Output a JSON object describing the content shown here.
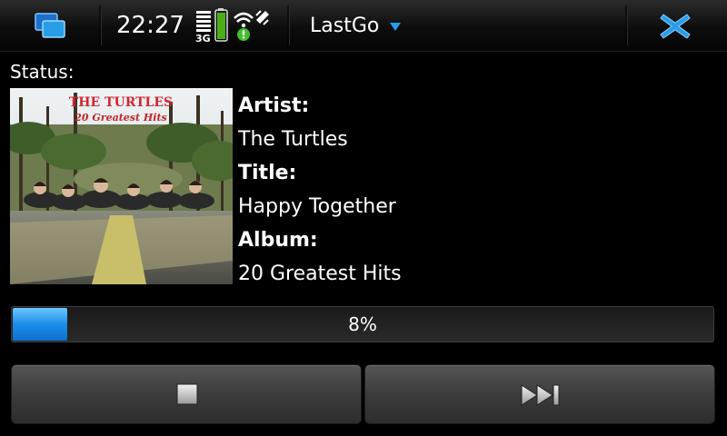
{
  "topbar": {
    "time": "22:27",
    "network_type": "3G",
    "app_title": "LastGo",
    "icons": {
      "task_switcher": "task-switcher-icon",
      "signal": "signal-strength-icon",
      "battery": "battery-icon",
      "wifi": "wifi-icon",
      "close": "close-icon",
      "menu": "chevron-down-icon"
    },
    "colors": {
      "accent": "#2a9de8",
      "battery": "#4caf1a"
    }
  },
  "now_playing": {
    "status_label": "Status:",
    "artist_label": "Artist:",
    "artist": "The Turtles",
    "title_label": "Title:",
    "title": "Happy Together",
    "album_label": "Album:",
    "album": "20 Greatest Hits",
    "cover": {
      "band_text": "THE TURTLES",
      "album_text": "20 Greatest Hits"
    }
  },
  "progress": {
    "percent": 8,
    "label": "8%"
  },
  "controls": {
    "stop": "stop-icon",
    "next": "skip-next-icon"
  }
}
